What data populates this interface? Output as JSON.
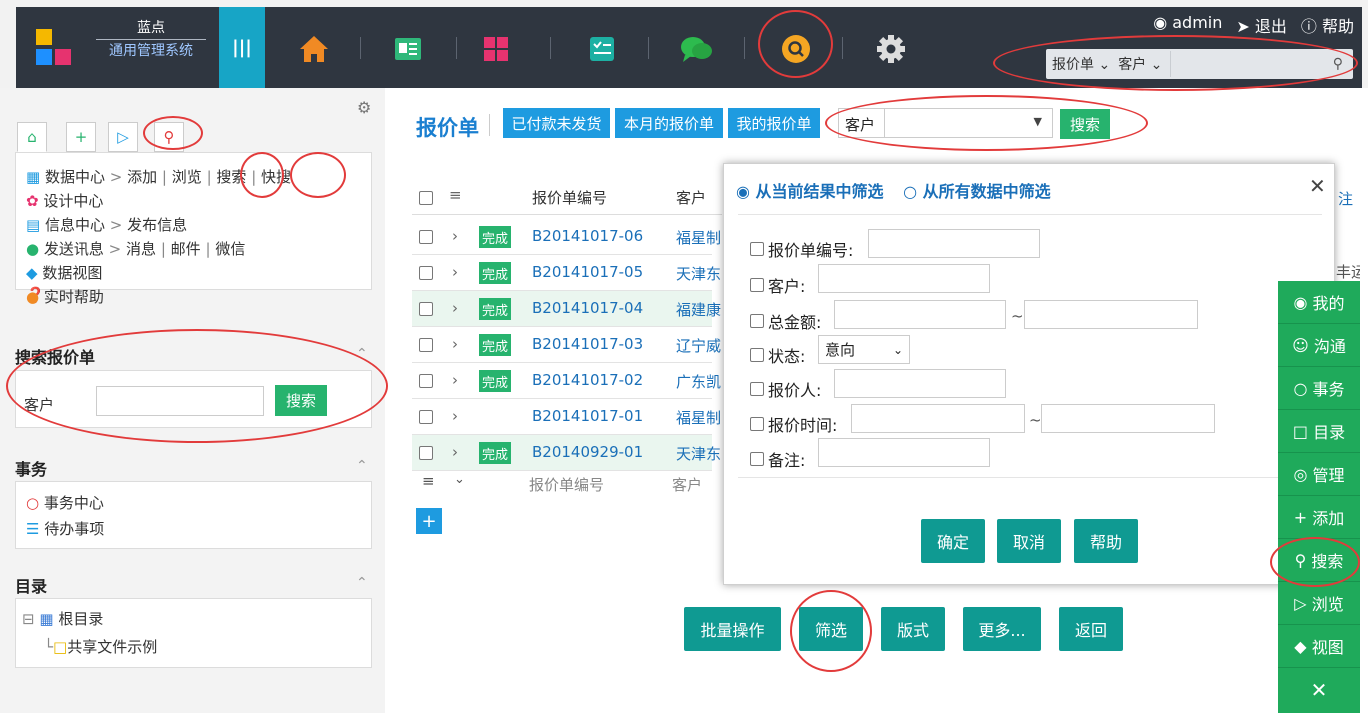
{
  "app": {
    "title": "蓝点",
    "subtitle": "通用管理系统"
  },
  "header": {
    "user": "admin",
    "logout": "退出",
    "help": "帮助",
    "search": {
      "module": "报价单",
      "field": "客户",
      "placeholder": ""
    },
    "nav_icons": [
      "menu-icon",
      "home-icon",
      "info-card-icon",
      "grid-apps-icon",
      "checklist-icon",
      "chat-icon",
      "search-icon",
      "gear-icon"
    ]
  },
  "sidebar": {
    "tabs": [
      "home-icon",
      "plus-icon",
      "play-icon",
      "search-icon"
    ],
    "links": {
      "data_center": "数据中心",
      "add": "添加",
      "browse": "浏览",
      "search": "搜索",
      "quick_search": "快搜",
      "design_center": "设计中心",
      "info_center": "信息中心",
      "publish_info": "发布信息",
      "send_msg": "发送讯息",
      "message": "消息",
      "mail": "邮件",
      "wechat": "微信",
      "data_view": "数据视图",
      "realtime_help": "实时帮助"
    },
    "search_panel": {
      "title": "搜索报价单",
      "label": "客户",
      "button": "搜索"
    },
    "affairs": {
      "title": "事务",
      "items": [
        "事务中心",
        "待办事项"
      ]
    },
    "catalog": {
      "title": "目录",
      "root": "根目录",
      "child": "共享文件示例"
    }
  },
  "main": {
    "title": "报价单",
    "quick_tabs": [
      "已付款未发货",
      "本月的报价单",
      "我的报价单"
    ],
    "filter_label": "客户",
    "filter_value": "",
    "search_button": "搜索",
    "columns": {
      "code": "报价单编号",
      "customer": "客户"
    },
    "rows": [
      {
        "status": "完成",
        "code": "B20141017-06",
        "customer": "福星制"
      },
      {
        "status": "完成",
        "code": "B20141017-05",
        "customer": "天津东"
      },
      {
        "status": "完成",
        "code": "B20141017-04",
        "customer": "福建康"
      },
      {
        "status": "完成",
        "code": "B20141017-03",
        "customer": "辽宁威"
      },
      {
        "status": "完成",
        "code": "B20141017-02",
        "customer": "广东凯"
      },
      {
        "status": "",
        "code": "B20141017-01",
        "customer": "福星制"
      },
      {
        "status": "完成",
        "code": "B20140929-01",
        "customer": "天津东"
      }
    ],
    "footer_cols": {
      "code": "报价单编号",
      "customer": "客户"
    },
    "partial_right": {
      "col": "注",
      "cell": "丰运"
    },
    "actions": [
      "批量操作",
      "筛选",
      "版式",
      "更多...",
      "返回"
    ]
  },
  "dialog": {
    "scope_current": "从当前结果中筛选",
    "scope_all": "从所有数据中筛选",
    "fields": {
      "code": "报价单编号:",
      "customer": "客户:",
      "amount": "总金额:",
      "status": "状态:",
      "status_value": "意向",
      "quoter": "报价人:",
      "time": "报价时间:",
      "remark": "备注:"
    },
    "tilde": "~",
    "buttons": {
      "ok": "确定",
      "cancel": "取消",
      "help": "帮助"
    }
  },
  "right_toolbar": [
    "我的",
    "沟通",
    "事务",
    "目录",
    "管理",
    "添加",
    "搜索",
    "浏览",
    "视图"
  ],
  "colors": {
    "dark": "#2f3640",
    "accent": "#17a5c6",
    "blue": "#1e9be0",
    "green": "#27b36e",
    "teal": "#0f9a92",
    "highlight": "#e23b3b"
  }
}
